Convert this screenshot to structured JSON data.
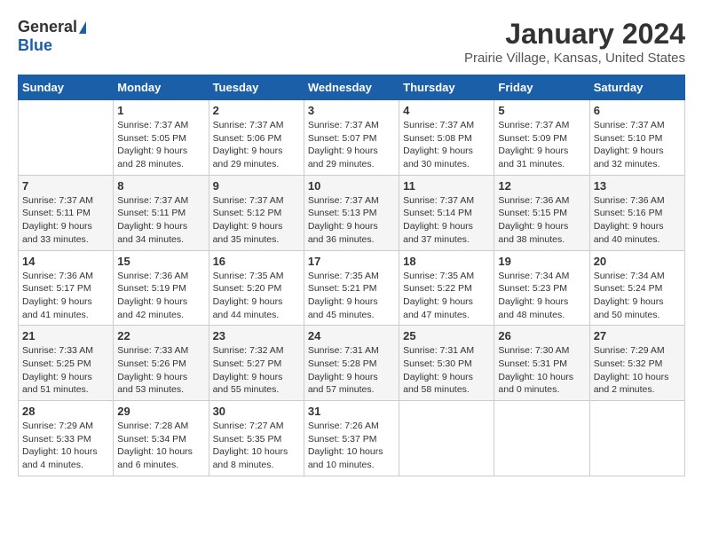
{
  "logo": {
    "general": "General",
    "blue": "Blue"
  },
  "title": "January 2024",
  "location": "Prairie Village, Kansas, United States",
  "days_of_week": [
    "Sunday",
    "Monday",
    "Tuesday",
    "Wednesday",
    "Thursday",
    "Friday",
    "Saturday"
  ],
  "weeks": [
    [
      {
        "day": "",
        "sunrise": "",
        "sunset": "",
        "daylight": ""
      },
      {
        "day": "1",
        "sunrise": "Sunrise: 7:37 AM",
        "sunset": "Sunset: 5:05 PM",
        "daylight": "Daylight: 9 hours and 28 minutes."
      },
      {
        "day": "2",
        "sunrise": "Sunrise: 7:37 AM",
        "sunset": "Sunset: 5:06 PM",
        "daylight": "Daylight: 9 hours and 29 minutes."
      },
      {
        "day": "3",
        "sunrise": "Sunrise: 7:37 AM",
        "sunset": "Sunset: 5:07 PM",
        "daylight": "Daylight: 9 hours and 29 minutes."
      },
      {
        "day": "4",
        "sunrise": "Sunrise: 7:37 AM",
        "sunset": "Sunset: 5:08 PM",
        "daylight": "Daylight: 9 hours and 30 minutes."
      },
      {
        "day": "5",
        "sunrise": "Sunrise: 7:37 AM",
        "sunset": "Sunset: 5:09 PM",
        "daylight": "Daylight: 9 hours and 31 minutes."
      },
      {
        "day": "6",
        "sunrise": "Sunrise: 7:37 AM",
        "sunset": "Sunset: 5:10 PM",
        "daylight": "Daylight: 9 hours and 32 minutes."
      }
    ],
    [
      {
        "day": "7",
        "sunrise": "Sunrise: 7:37 AM",
        "sunset": "Sunset: 5:11 PM",
        "daylight": "Daylight: 9 hours and 33 minutes."
      },
      {
        "day": "8",
        "sunrise": "Sunrise: 7:37 AM",
        "sunset": "Sunset: 5:11 PM",
        "daylight": "Daylight: 9 hours and 34 minutes."
      },
      {
        "day": "9",
        "sunrise": "Sunrise: 7:37 AM",
        "sunset": "Sunset: 5:12 PM",
        "daylight": "Daylight: 9 hours and 35 minutes."
      },
      {
        "day": "10",
        "sunrise": "Sunrise: 7:37 AM",
        "sunset": "Sunset: 5:13 PM",
        "daylight": "Daylight: 9 hours and 36 minutes."
      },
      {
        "day": "11",
        "sunrise": "Sunrise: 7:37 AM",
        "sunset": "Sunset: 5:14 PM",
        "daylight": "Daylight: 9 hours and 37 minutes."
      },
      {
        "day": "12",
        "sunrise": "Sunrise: 7:36 AM",
        "sunset": "Sunset: 5:15 PM",
        "daylight": "Daylight: 9 hours and 38 minutes."
      },
      {
        "day": "13",
        "sunrise": "Sunrise: 7:36 AM",
        "sunset": "Sunset: 5:16 PM",
        "daylight": "Daylight: 9 hours and 40 minutes."
      }
    ],
    [
      {
        "day": "14",
        "sunrise": "Sunrise: 7:36 AM",
        "sunset": "Sunset: 5:17 PM",
        "daylight": "Daylight: 9 hours and 41 minutes."
      },
      {
        "day": "15",
        "sunrise": "Sunrise: 7:36 AM",
        "sunset": "Sunset: 5:19 PM",
        "daylight": "Daylight: 9 hours and 42 minutes."
      },
      {
        "day": "16",
        "sunrise": "Sunrise: 7:35 AM",
        "sunset": "Sunset: 5:20 PM",
        "daylight": "Daylight: 9 hours and 44 minutes."
      },
      {
        "day": "17",
        "sunrise": "Sunrise: 7:35 AM",
        "sunset": "Sunset: 5:21 PM",
        "daylight": "Daylight: 9 hours and 45 minutes."
      },
      {
        "day": "18",
        "sunrise": "Sunrise: 7:35 AM",
        "sunset": "Sunset: 5:22 PM",
        "daylight": "Daylight: 9 hours and 47 minutes."
      },
      {
        "day": "19",
        "sunrise": "Sunrise: 7:34 AM",
        "sunset": "Sunset: 5:23 PM",
        "daylight": "Daylight: 9 hours and 48 minutes."
      },
      {
        "day": "20",
        "sunrise": "Sunrise: 7:34 AM",
        "sunset": "Sunset: 5:24 PM",
        "daylight": "Daylight: 9 hours and 50 minutes."
      }
    ],
    [
      {
        "day": "21",
        "sunrise": "Sunrise: 7:33 AM",
        "sunset": "Sunset: 5:25 PM",
        "daylight": "Daylight: 9 hours and 51 minutes."
      },
      {
        "day": "22",
        "sunrise": "Sunrise: 7:33 AM",
        "sunset": "Sunset: 5:26 PM",
        "daylight": "Daylight: 9 hours and 53 minutes."
      },
      {
        "day": "23",
        "sunrise": "Sunrise: 7:32 AM",
        "sunset": "Sunset: 5:27 PM",
        "daylight": "Daylight: 9 hours and 55 minutes."
      },
      {
        "day": "24",
        "sunrise": "Sunrise: 7:31 AM",
        "sunset": "Sunset: 5:28 PM",
        "daylight": "Daylight: 9 hours and 57 minutes."
      },
      {
        "day": "25",
        "sunrise": "Sunrise: 7:31 AM",
        "sunset": "Sunset: 5:30 PM",
        "daylight": "Daylight: 9 hours and 58 minutes."
      },
      {
        "day": "26",
        "sunrise": "Sunrise: 7:30 AM",
        "sunset": "Sunset: 5:31 PM",
        "daylight": "Daylight: 10 hours and 0 minutes."
      },
      {
        "day": "27",
        "sunrise": "Sunrise: 7:29 AM",
        "sunset": "Sunset: 5:32 PM",
        "daylight": "Daylight: 10 hours and 2 minutes."
      }
    ],
    [
      {
        "day": "28",
        "sunrise": "Sunrise: 7:29 AM",
        "sunset": "Sunset: 5:33 PM",
        "daylight": "Daylight: 10 hours and 4 minutes."
      },
      {
        "day": "29",
        "sunrise": "Sunrise: 7:28 AM",
        "sunset": "Sunset: 5:34 PM",
        "daylight": "Daylight: 10 hours and 6 minutes."
      },
      {
        "day": "30",
        "sunrise": "Sunrise: 7:27 AM",
        "sunset": "Sunset: 5:35 PM",
        "daylight": "Daylight: 10 hours and 8 minutes."
      },
      {
        "day": "31",
        "sunrise": "Sunrise: 7:26 AM",
        "sunset": "Sunset: 5:37 PM",
        "daylight": "Daylight: 10 hours and 10 minutes."
      },
      {
        "day": "",
        "sunrise": "",
        "sunset": "",
        "daylight": ""
      },
      {
        "day": "",
        "sunrise": "",
        "sunset": "",
        "daylight": ""
      },
      {
        "day": "",
        "sunrise": "",
        "sunset": "",
        "daylight": ""
      }
    ]
  ]
}
